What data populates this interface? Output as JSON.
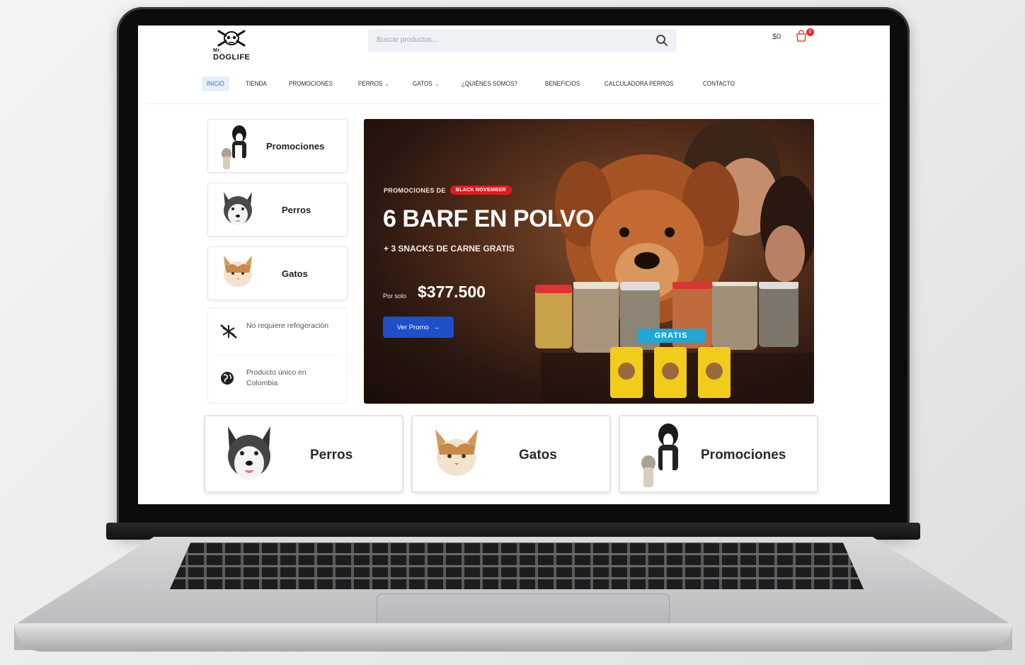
{
  "header": {
    "logo_line1": "Mr.",
    "logo_line2": "DOGLIFE",
    "search_placeholder": "Buscar productos...",
    "cart_total": "$0",
    "cart_count": "0"
  },
  "nav": {
    "items": [
      {
        "label": "INICIO",
        "active": true
      },
      {
        "label": "TIENDA"
      },
      {
        "label": "PROMOCIONES"
      },
      {
        "label": "PERROS",
        "dropdown": true
      },
      {
        "label": "GATOS",
        "dropdown": true
      },
      {
        "label": "¿QUIÉNES SOMOS?"
      },
      {
        "label": "BENEFICIOS"
      },
      {
        "label": "CALCULADORA PERROS"
      },
      {
        "label": "CONTACTO"
      }
    ]
  },
  "sidebar": {
    "cards": [
      {
        "label": "Promociones"
      },
      {
        "label": "Perros"
      },
      {
        "label": "Gatos"
      }
    ],
    "features": [
      {
        "text": "No requiere refrigeración",
        "icon": "no-snowflake-icon"
      },
      {
        "text": "Producto único en Colombia",
        "icon": "globe-icon"
      }
    ]
  },
  "hero": {
    "kicker": "PROMOCIONES DE",
    "badge": "BLACK NOVEMBER",
    "title": "6 BARF EN POLVO",
    "subtitle": "+ 3 SNACKS DE CARNE GRATIS",
    "price_prefix": "Por solo",
    "price": "$377.500",
    "button_label": "Ver Promo",
    "ribbon": "GRATIS"
  },
  "categories": [
    {
      "label": "Perros"
    },
    {
      "label": "Gatos"
    },
    {
      "label": "Promociones"
    }
  ],
  "colors": {
    "accent": "#1f4fc9",
    "badge": "#e3191f",
    "nav_active": "#3b6cd6",
    "ribbon": "#22a6d6"
  }
}
